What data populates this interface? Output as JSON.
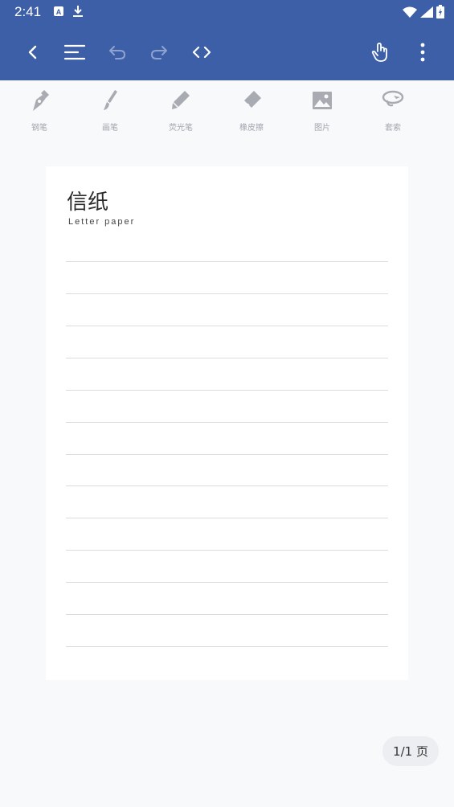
{
  "status": {
    "time": "2:41"
  },
  "tools": [
    {
      "label": "钢笔",
      "icon": "fountain-pen-icon"
    },
    {
      "label": "画笔",
      "icon": "brush-icon"
    },
    {
      "label": "荧光笔",
      "icon": "highlighter-icon"
    },
    {
      "label": "橡皮擦",
      "icon": "eraser-icon"
    },
    {
      "label": "图片",
      "icon": "image-icon"
    },
    {
      "label": "套索",
      "icon": "lasso-icon"
    }
  ],
  "paper": {
    "title": "信纸",
    "subtitle": "Letter paper"
  },
  "pager": {
    "label": "1/1 页"
  },
  "colors": {
    "accent": "#3d5fa8",
    "background": "#f8f9fb",
    "paper": "#ffffff"
  }
}
